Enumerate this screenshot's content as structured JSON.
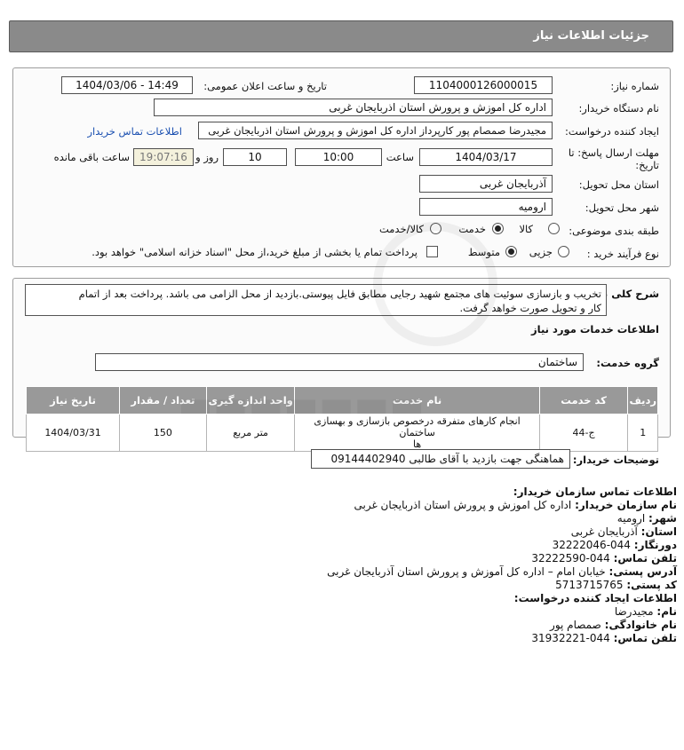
{
  "header": {
    "title": "جزئیات اطلاعات نیاز"
  },
  "need_number": {
    "label": "شماره نیاز:",
    "value": "1104000126000015"
  },
  "announce": {
    "label": "تاریخ و ساعت اعلان عمومی:",
    "value": "1404/03/06 - 14:49"
  },
  "buyer_org": {
    "label": "نام دستگاه خریدار:",
    "value": "اداره کل اموزش و پرورش استان اذربایجان غربی"
  },
  "requester": {
    "label": "ایجاد کننده درخواست:",
    "value": "مجیدرضا صمصام پور کارپرداز اداره کل اموزش و پرورش استان اذربایجان غربی",
    "contact_link": "اطلاعات تماس خریدار"
  },
  "deadline": {
    "label_line1": "مهلت ارسال پاسخ: تا",
    "label_line2": "تاریخ:",
    "date": "1404/03/17",
    "time_label": "ساعت",
    "time": "10:00",
    "days": "10",
    "days_label": "روز و",
    "remaining": "19:07:16",
    "remaining_label": "ساعت باقی مانده"
  },
  "province": {
    "label": "استان محل تحویل:",
    "value": "آذربایجان غربی"
  },
  "city": {
    "label": "شهر محل تحویل:",
    "value": "ارومیه"
  },
  "category": {
    "label": "طبقه بندی موضوعی:",
    "options": [
      "کالا",
      "خدمت",
      "کالا/خدمت"
    ],
    "selected": "خدمت"
  },
  "process": {
    "label": "نوع فرآیند خرید :",
    "options": [
      "جزیی",
      "متوسط"
    ],
    "selected": "متوسط",
    "payment_text": "پرداخت تمام یا بخشی از مبلغ خرید،از محل \"اسناد خزانه اسلامی\" خواهد بود."
  },
  "description": {
    "label": "شرح کلی نیاز:",
    "line1": "تخریب و بازسازی سوئیت های مجتمع شهید رجایی مطابق فایل پیوستی.بازدید از محل الزامی می باشد. پرداخت بعد از اتمام",
    "line2": "کار و تحویل صورت خواهد گرفت."
  },
  "services": {
    "title": "اطلاعات خدمات مورد نیاز",
    "group_label": "گروه خدمت:",
    "group_value": "ساختمان",
    "columns": [
      "ردیف",
      "کد خدمت",
      "نام خدمت",
      "واحد اندازه گیری",
      "تعداد / مقدار",
      "تاریخ نیاز"
    ],
    "rows": [
      {
        "row": "1",
        "code": "ج-44",
        "name_line1": "انجام کارهای متفرقه درخصوص بازسازی و بهسازی ساختمان",
        "name_line2": "ها",
        "unit": "متر مربع",
        "qty": "150",
        "date": "1404/03/31"
      }
    ]
  },
  "buyer_notes": {
    "label": "توضیحات خریدار:",
    "value": "هماهنگی جهت بازدید با آقای طالبی 09144402940"
  },
  "contact": {
    "title": "اطلاعات تماس سازمان خریدار:",
    "org_label": "نام سازمان خریدار:",
    "org_value": "اداره کل اموزش و پرورش استان اذربایجان غربی",
    "city_label": "شهر:",
    "city_value": "ارومیه",
    "province_label": "استان:",
    "province_value": "آذربایجان غربی",
    "fax_label": "دورنگار:",
    "fax_value": "044-32222046",
    "phone_label": "تلفن تماس:",
    "phone_value": "044-32222590",
    "address_label": "آدرس پستی:",
    "address_value": "خیابان امام – اداره کل آموزش و پرورش استان آذربایجان غربی",
    "postal_label": "کد پستی:",
    "postal_value": "5713715765",
    "creator_title": "اطلاعات ایجاد کننده درخواست:",
    "first_label": "نام:",
    "first_value": "مجیدرضا",
    "last_label": "نام خانوادگی:",
    "last_value": "صمصام پور",
    "cphone_label": "تلفن تماس:",
    "cphone_value": "044-31932221"
  }
}
